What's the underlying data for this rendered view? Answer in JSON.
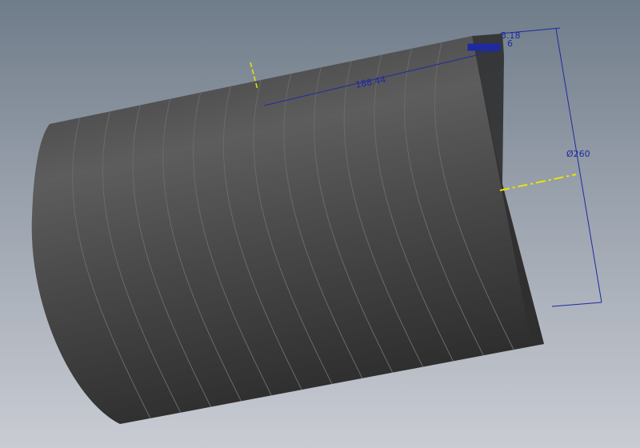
{
  "viewport": {
    "type": "3D CAD model view",
    "background": [
      "#6f7c89",
      "#c9ccd3"
    ]
  },
  "model": {
    "name": "cylinder",
    "body_color": "#4a4a4a",
    "segment_lines": 13
  },
  "dimensions": {
    "thickness": "3.18",
    "small": "6",
    "length": "188.44",
    "diameter": "Ø260",
    "color": "#1f2aa0"
  },
  "axis_color": "#e6e600"
}
